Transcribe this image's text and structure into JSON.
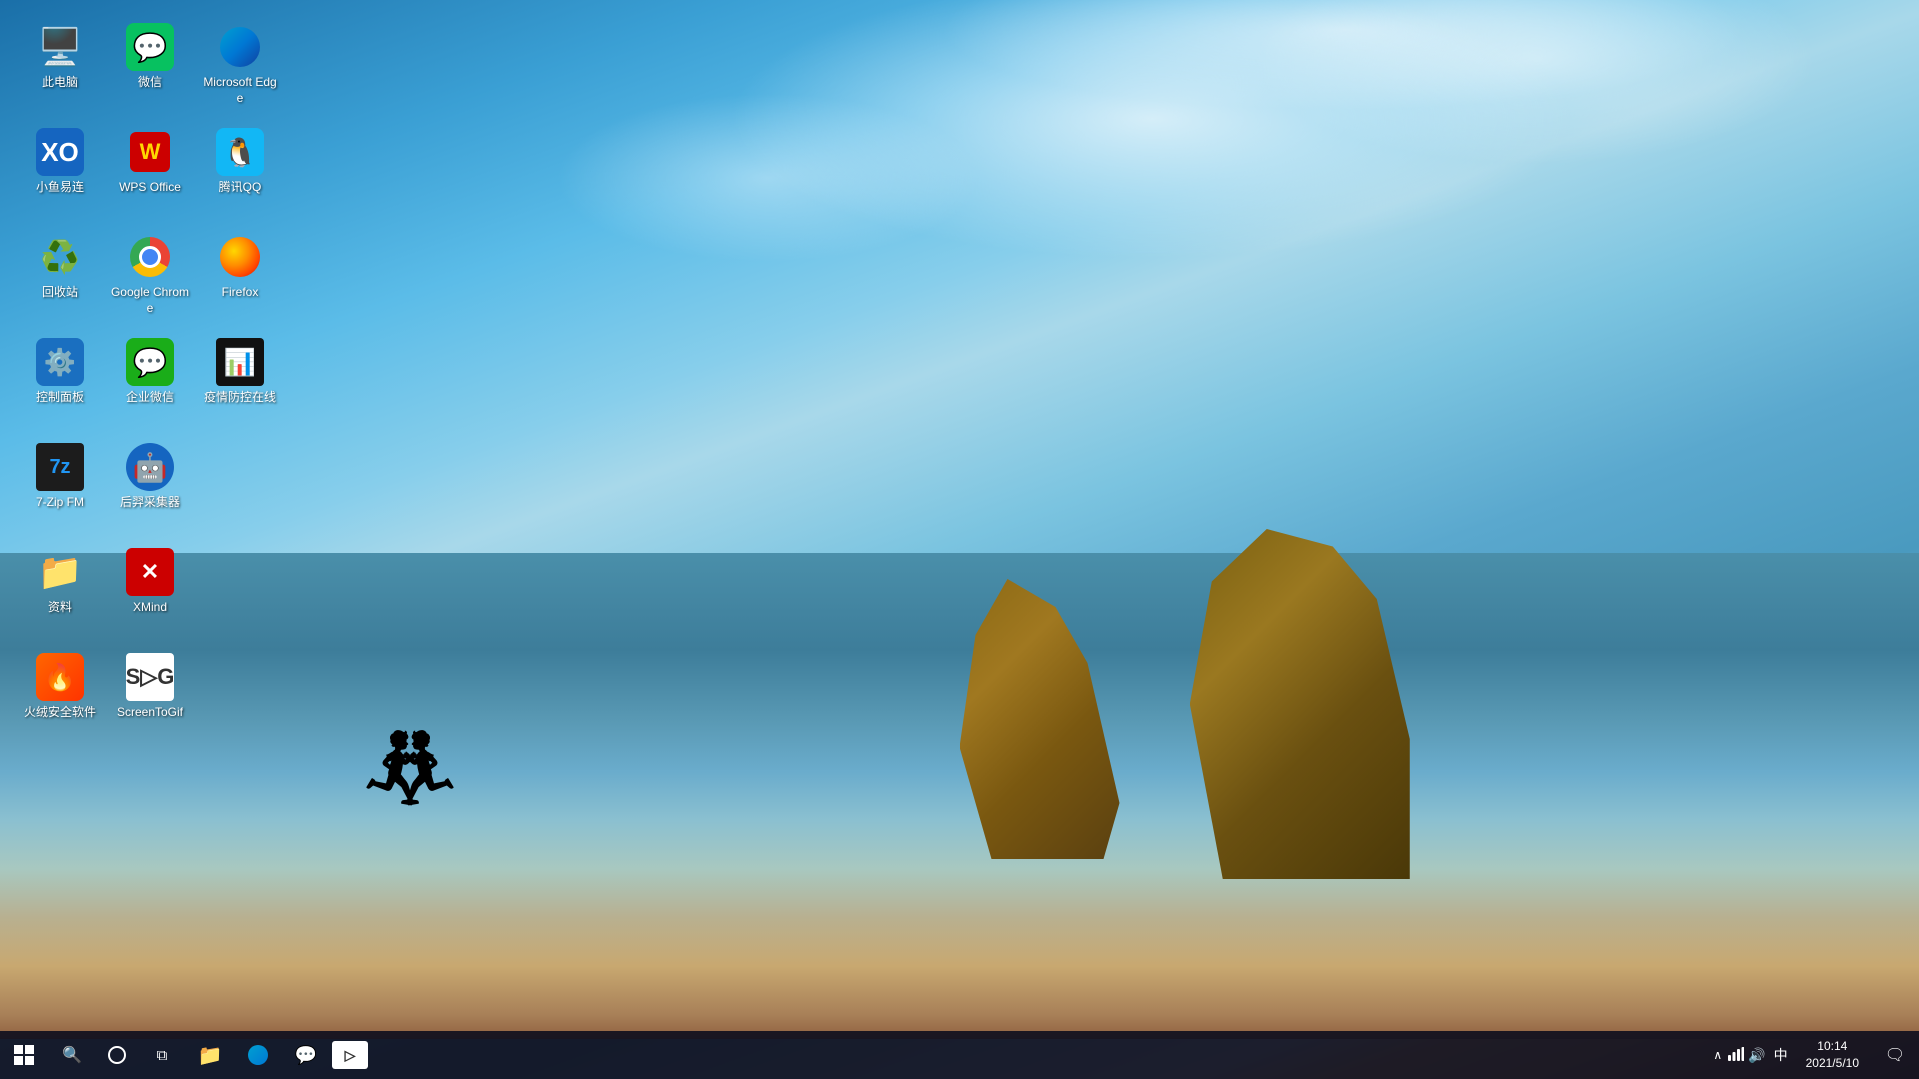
{
  "desktop": {
    "icons": [
      {
        "id": "pc",
        "label": "此电脑",
        "emoji": "🖥️",
        "row": 1,
        "col": 1
      },
      {
        "id": "wechat",
        "label": "微信",
        "emoji": "💬",
        "row": 1,
        "col": 2
      },
      {
        "id": "edge",
        "label": "Microsoft Edge",
        "emoji": "edge",
        "row": 1,
        "col": 3
      },
      {
        "id": "easylink",
        "label": "小鱼易连",
        "emoji": "🔵",
        "row": 2,
        "col": 1
      },
      {
        "id": "wps",
        "label": "WPS Office",
        "emoji": "wps",
        "row": 2,
        "col": 2
      },
      {
        "id": "qq",
        "label": "腾讯QQ",
        "emoji": "🐧",
        "row": 2,
        "col": 3
      },
      {
        "id": "recycle",
        "label": "回收站",
        "emoji": "🗑️",
        "row": 3,
        "col": 1
      },
      {
        "id": "chrome",
        "label": "Google Chrome",
        "emoji": "chrome",
        "row": 3,
        "col": 2
      },
      {
        "id": "firefox",
        "label": "Firefox",
        "emoji": "firefox",
        "row": 3,
        "col": 3
      },
      {
        "id": "controlpanel",
        "label": "控制面板",
        "emoji": "⚙️",
        "row": 4,
        "col": 1
      },
      {
        "id": "corpwechat",
        "label": "企业微信",
        "emoji": "💼",
        "row": 4,
        "col": 2
      },
      {
        "id": "yiqing",
        "label": "疫情防控在线",
        "emoji": "📊",
        "row": 4,
        "col": 3
      },
      {
        "id": "7zip",
        "label": "7-Zip FM",
        "emoji": "7z",
        "row": 5,
        "col": 1
      },
      {
        "id": "jiqun",
        "label": "后羿采集器",
        "emoji": "🤖",
        "row": 5,
        "col": 2
      },
      {
        "id": "folder",
        "label": "资料",
        "emoji": "📁",
        "row": 6,
        "col": 1
      },
      {
        "id": "xmind",
        "label": "XMind",
        "emoji": "xmind",
        "row": 6,
        "col": 2
      },
      {
        "id": "firewall",
        "label": "火绒安全软件",
        "emoji": "🔥",
        "row": 7,
        "col": 1
      },
      {
        "id": "screentogif",
        "label": "ScreenToGif",
        "emoji": "📽️",
        "row": 7,
        "col": 2
      }
    ]
  },
  "taskbar": {
    "start_label": "开始",
    "search_placeholder": "搜索",
    "pinned_apps": [
      {
        "id": "taskview",
        "emoji": "⧉"
      },
      {
        "id": "explorer",
        "emoji": "📁"
      },
      {
        "id": "edge-task",
        "emoji": "🌐"
      },
      {
        "id": "chat-task",
        "emoji": "💬"
      },
      {
        "id": "screentogif-task",
        "emoji": "🎬"
      }
    ],
    "clock": {
      "time": "10:14",
      "date": "2021/5/10"
    },
    "tray": {
      "chevron": "^",
      "network": "🌐",
      "volume": "🔊",
      "language": "中",
      "notification": "🗨️"
    }
  }
}
